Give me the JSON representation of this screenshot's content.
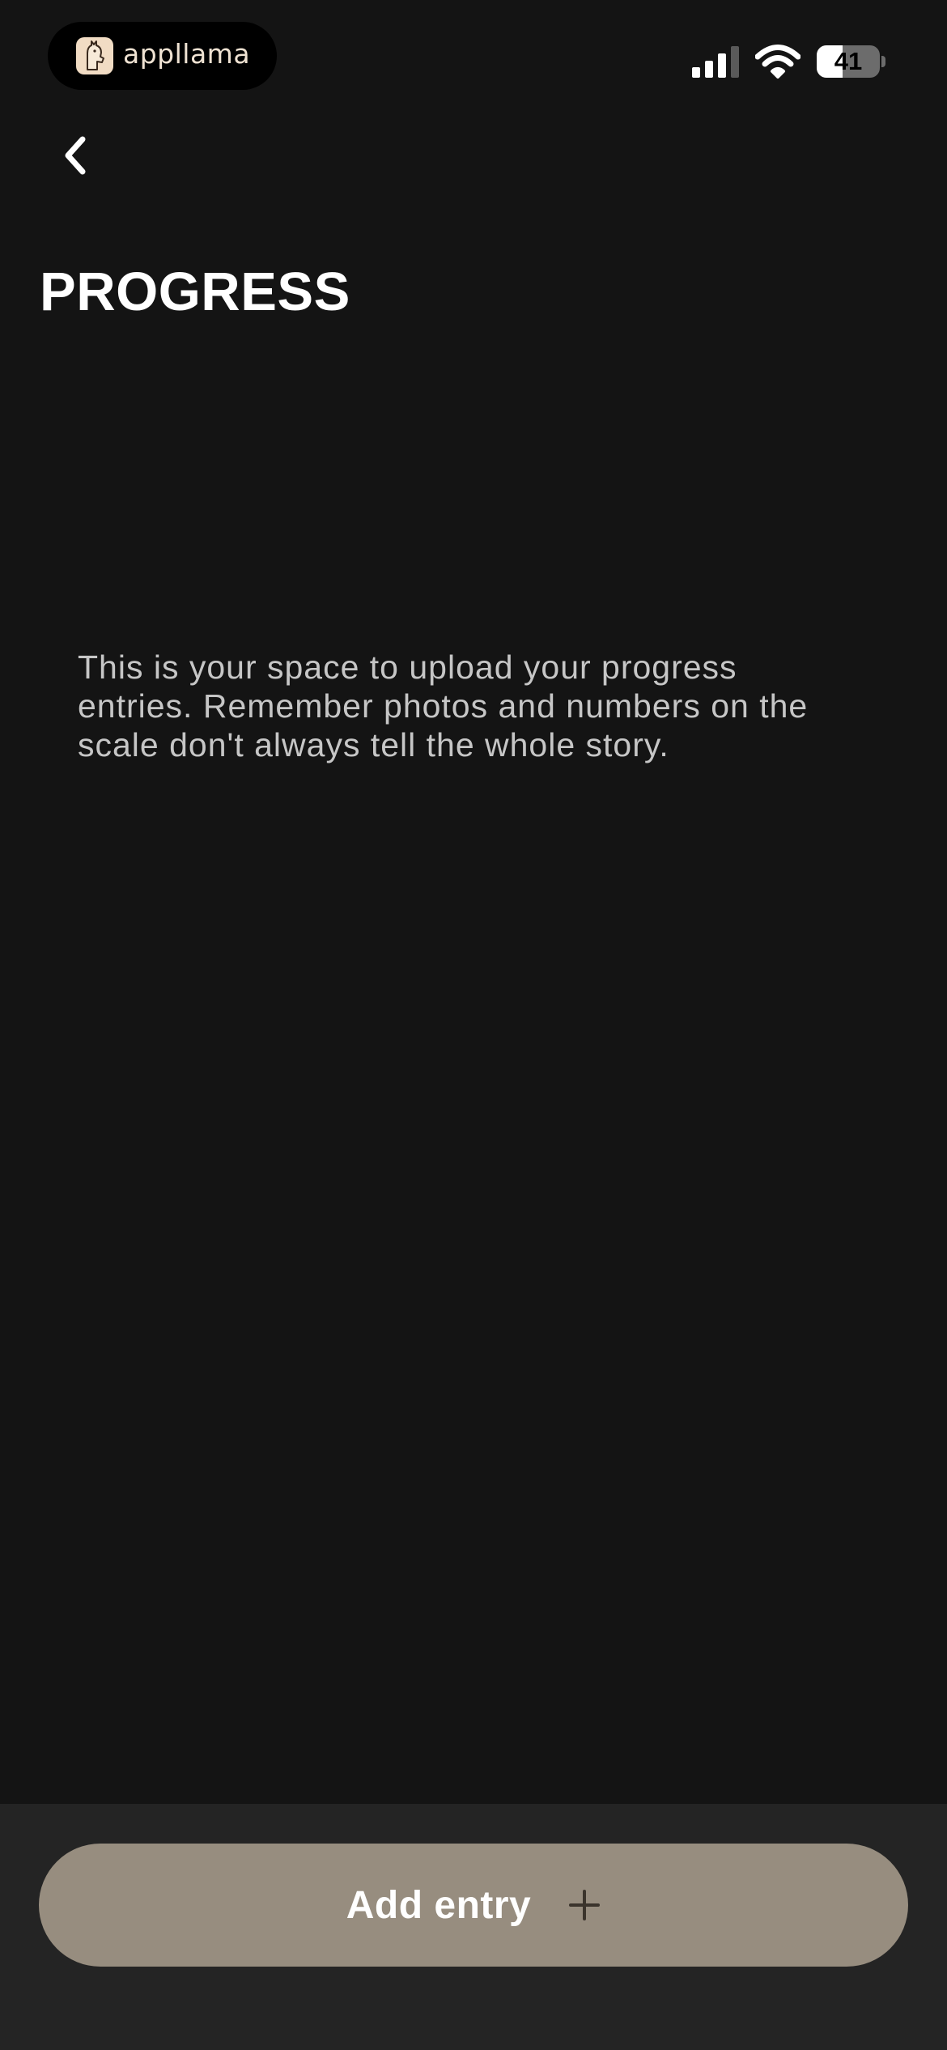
{
  "status_bar": {
    "app_badge": {
      "name": "appllama",
      "logo": "llama-logo-icon"
    },
    "signal": "cellular-signal-icon",
    "wifi": "wifi-icon",
    "battery": {
      "level": "41",
      "percent": 41,
      "icon": "battery-icon"
    }
  },
  "nav": {
    "back_icon": "chevron-left-icon"
  },
  "page": {
    "title": "PROGRESS",
    "empty_message": "This is your space to upload your progress entries. Remember photos and numbers on the scale don't always tell the whole story."
  },
  "footer": {
    "add_entry_label": "Add entry",
    "add_icon": "plus-icon"
  },
  "colors": {
    "background": "#141414",
    "bottom_bar": "#242424",
    "button": "#978d7f",
    "plus_icon": "#3b342c",
    "text_primary": "#ffffff",
    "text_secondary": "#c6c6c6"
  }
}
